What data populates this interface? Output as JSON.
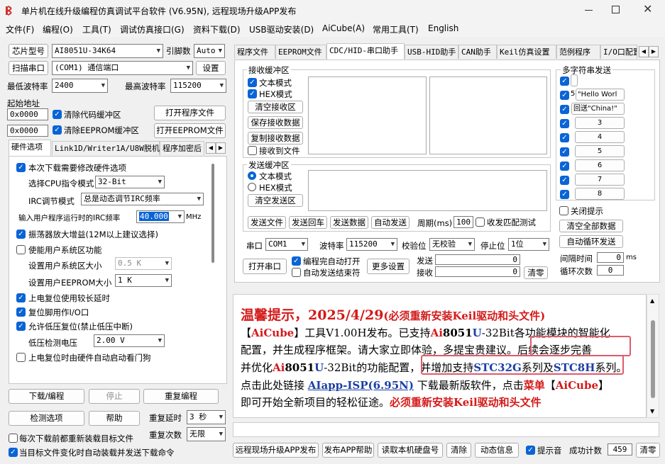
{
  "title": "单片机在线升级编程仿真调试平台软件 (V6.95N), 远程现场升级APP发布",
  "menu": [
    "文件(F)",
    "编程(O)",
    "工具(T)",
    "调试仿真接口(G)",
    "资料下载(D)",
    "USB驱动安装(D)",
    "AiCube(A)",
    "常用工具(T)",
    "English"
  ],
  "left": {
    "chip_btn": "芯片型号",
    "chip_value": "AI8051U-34K64",
    "pin_label": "引脚数",
    "pin_value": "Auto",
    "scan_btn": "扫描串口",
    "port_value": "(COM1) 通信端口",
    "settings_btn": "设置",
    "min_baud_label": "最低波特率",
    "min_baud_value": "2400",
    "max_baud_label": "最高波特率",
    "max_baud_value": "115200",
    "start_addr_label": "起始地址",
    "addr1": "0x0000",
    "clear_code": "清除代码缓冲区",
    "open_prog": "打开程序文件",
    "addr2": "0x0000",
    "clear_eeprom": "清除EEPROM缓冲区",
    "open_eeprom": "打开EEPROM文件",
    "tabs": [
      "硬件选项",
      "Link1D/Writer1A/U8W脱机",
      "程序加密后"
    ],
    "opt_modify": "本次下载需要修改硬件选项",
    "cpu_label": "选择CPU指令模式",
    "cpu_value": "32-Bit",
    "irc_label": "IRC调节模式",
    "irc_value": "总是动态调节IRC频率",
    "freq_label": "输入用户程序运行时的IRC频率",
    "freq_value": "40.000",
    "freq_unit": "MHz",
    "opt_osc": "振荡器放大增益(12M以上建议选择)",
    "opt_user_area": "使能用户系统区功能",
    "user_area_label": "设置用户系统区大小",
    "user_area_value": "0.5 K",
    "eeprom_size_label": "设置用户EEPROM大小",
    "eeprom_size_value": "1   K",
    "opt_delay": "上电复位使用较长延时",
    "opt_reset_io": "复位脚用作I/O口",
    "opt_lvr": "允许低压复位(禁止低压中断)",
    "lvd_label": "低压检测电压",
    "lvd_value": "2.00 V",
    "opt_wdt": "上电复位时由硬件自动启动看门狗",
    "download_btn": "下载/编程",
    "stop_btn": "停止",
    "reprog_btn": "重复编程",
    "detect_btn": "检测选项",
    "help_btn": "帮助",
    "repeat_delay_label": "重复延时",
    "repeat_delay_value": "3 秒",
    "repeat_count_label": "重复次数",
    "repeat_count_value": "无限",
    "reload_each": "每次下载前都重新装载目标文件",
    "auto_load": "当目标文件变化时自动装载并发送下载命令"
  },
  "right_tabs": [
    "程序文件",
    "EEPROM文件",
    "CDC/HID-串口助手",
    "USB-HID助手",
    "CAN助手",
    "Keil仿真设置",
    "范例程序",
    "I/O口配置"
  ],
  "serial": {
    "recv_group": "接收缓冲区",
    "text_mode": "文本模式",
    "hex_mode": "HEX模式",
    "clear_recv": "清空接收区",
    "save_recv": "保存接收数据",
    "copy_recv": "复制接收数据",
    "recv_to_file": "接收到文件",
    "send_group": "发送缓冲区",
    "send_text": "文本模式",
    "send_hex": "HEX模式",
    "clear_send": "清空发送区",
    "send_file": "发送文件",
    "send_return": "发送回车",
    "send_data": "发送数据",
    "auto_send": "自动发送",
    "period_label": "周期(ms)",
    "period_value": "100",
    "match_label": "收发匹配测试",
    "port_label": "串口",
    "port_value": "COM1",
    "baud_label": "波特率",
    "baud_value": "115200",
    "parity_label": "校验位",
    "parity_value": "无校验",
    "stop_label": "停止位",
    "stop_value": "1位",
    "open_port": "打开串口",
    "auto_open": "编程完自动打开",
    "auto_end": "自动发送结束符",
    "more_settings": "更多设置",
    "send_count_label": "发送",
    "send_count": "0",
    "recv_count_label": "接收",
    "recv_count": "0",
    "clear_count": "清零"
  },
  "multi": {
    "title": "多字符串发送",
    "rows": [
      "",
      "\"Hello Worl",
      "回送\"China!\"",
      "3",
      "4",
      "5",
      "6",
      "7",
      "8"
    ],
    "row_prefix": [
      "",
      "5",
      ""
    ],
    "close_tip": "关闭提示",
    "clear_all": "清空全部数据",
    "auto_loop": "自动循环发送",
    "interval_label": "间隔时间",
    "interval_value": "0",
    "interval_unit": "ms",
    "loop_label": "循环次数",
    "loop_value": "0"
  },
  "notice": {
    "headline": "温馨提示，2025/4/29",
    "headline_note": "(必须重新安装Keil驱动和头文件)",
    "l2a": "【",
    "l2b": "AiCube",
    "l2c": "】工具V1.00H发布。已支持",
    "l2d": "Ai",
    "l2e": "8051",
    "l2f": "U",
    "l2g": "-32Bit各功能模块的智能化",
    "l3a": "配置，并生成程序框架。请大家立即体验，多提宝贵建议。",
    "l3b": "后续会逐步完善",
    "l4a": "并优化",
    "l4b": "Ai",
    "l4c": "8051",
    "l4d": "U",
    "l4e": "-32Bit的功能配置，",
    "l4f": "并增加支持",
    "l4g": "STC32G",
    "l4h": "系列及",
    "l4i": "STC8H",
    "l4j": "系列。",
    "l5a": "点击此处链接",
    "l5b": "AIapp-ISP(6.95N)",
    "l5c": "下载最新版软件，点击",
    "l5d": "菜单",
    "l5e": "【",
    "l5f": "AiCube",
    "l5g": "】",
    "l6a": "即可开始全新项目的轻松征途。",
    "l6b": "必须重新安装Keil驱动和头文件"
  },
  "bottom": {
    "remote_btn": "远程现场升级APP发布",
    "help_btn": "发布APP帮助",
    "read_disk": "读取本机硬盘号",
    "clear_btn": "清除",
    "animation": "动态信息",
    "sound": "提示音",
    "count_label": "成功计数",
    "count_value": "459",
    "reset_btn": "清零"
  }
}
